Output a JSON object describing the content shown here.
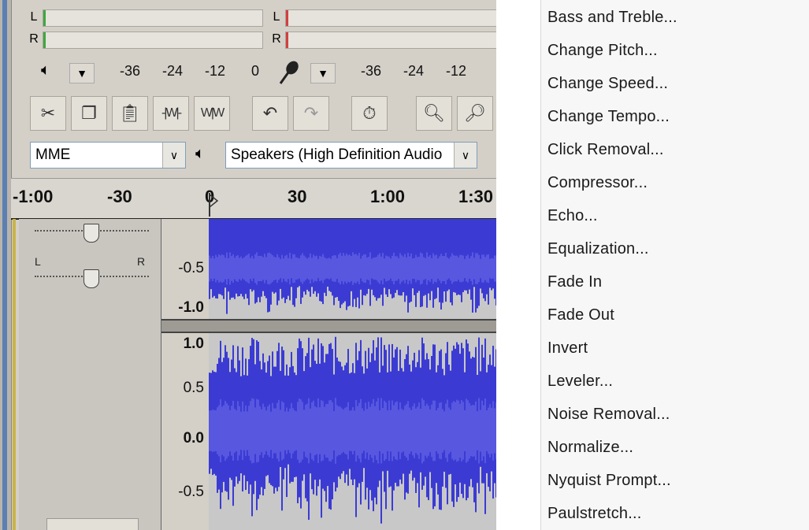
{
  "meter": {
    "l": "L",
    "r": "R"
  },
  "playback_scale": [
    "-36",
    "-24",
    "-12",
    "0"
  ],
  "record_scale": [
    "-36",
    "-24",
    "-12"
  ],
  "device": {
    "host": "MME",
    "output": "Speakers (High Definition Audio"
  },
  "timeline": {
    "labels": [
      "-1:00",
      "-30",
      "0",
      "30",
      "1:00",
      "1:30"
    ]
  },
  "track": {
    "pan_left": "L",
    "pan_right": "R"
  },
  "vscale": {
    "top_track": [
      "-0.5",
      "-1.0"
    ],
    "bottom_track": [
      "1.0",
      "0.5",
      "0.0",
      "-0.5"
    ]
  },
  "menu": {
    "items": [
      "Bass and Treble...",
      "Change Pitch...",
      "Change Speed...",
      "Change Tempo...",
      "Click Removal...",
      "Compressor...",
      "Echo...",
      "Equalization...",
      "Fade In",
      "Fade Out",
      "Invert",
      "Leveler...",
      "Noise Removal...",
      "Normalize...",
      "Nyquist Prompt...",
      "Paulstretch..."
    ]
  },
  "icons": {
    "speaker": "speaker-icon",
    "microphone": "microphone-icon",
    "cut": "cut-icon",
    "copy": "copy-icon",
    "paste": "paste-icon",
    "trim": "trim-icon",
    "silence": "silence-icon",
    "undo": "undo-icon",
    "redo": "redo-icon",
    "sync_lock": "sync-lock-icon",
    "zoom_in": "zoom-in-icon",
    "zoom_out": "zoom-out-icon"
  },
  "colors": {
    "waveform": "#3b3bd4",
    "waveform_rms": "#5757e0",
    "menu_bg": "#f7f7f7",
    "toolbar_bg": "#d4d0c8"
  }
}
